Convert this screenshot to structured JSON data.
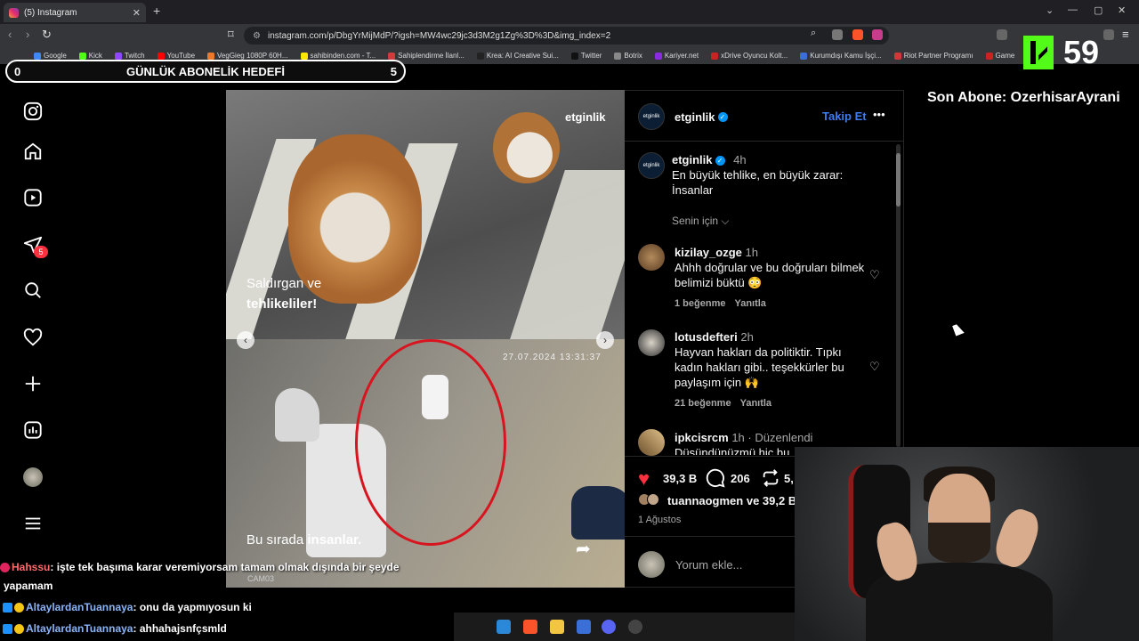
{
  "browser": {
    "tab_title": "(5) Instagram",
    "url": "instagram.com/p/DbgYrMijMdP/?igsh=MW4wc29jc3d3M2g1Zg%3D%3D&img_index=2",
    "bookmarks": [
      {
        "label": "Google",
        "color": "#4285f4"
      },
      {
        "label": "Kick",
        "color": "#53fc18"
      },
      {
        "label": "Twitch",
        "color": "#9146ff"
      },
      {
        "label": "YouTube",
        "color": "#ff0000"
      },
      {
        "label": "VegGieg 1080P 60H...",
        "color": "#e77a2e"
      },
      {
        "label": "sahibinden.com - T...",
        "color": "#ffe800"
      },
      {
        "label": "Sahiplendirme İlanl...",
        "color": "#d13b3b"
      },
      {
        "label": "Krea: AI Creative Sui...",
        "color": "#222222"
      },
      {
        "label": "Twitter",
        "color": "#111111"
      },
      {
        "label": "Botrix",
        "color": "#888888"
      },
      {
        "label": "Kariyer.net",
        "color": "#8a2be2"
      },
      {
        "label": "xDrive Oyuncu Kolt...",
        "color": "#cc2222"
      },
      {
        "label": "Kurumdışı Kamu İşçi...",
        "color": "#3a6fd8"
      },
      {
        "label": "Riot Partner Programı",
        "color": "#d13639"
      },
      {
        "label": "Game",
        "color": "#cc2222"
      }
    ]
  },
  "overlay": {
    "goal_start": "0",
    "goal_title": "GÜNLÜK ABONELİK HEDEFİ",
    "goal_end": "5",
    "viewers": "59",
    "last_sub": "Son Abone: OzerhisarAyrani"
  },
  "nav": {
    "notifications_badge": "5",
    "icons": [
      "instagram-icon",
      "home-icon",
      "reels-icon",
      "messages-icon",
      "search-icon",
      "heart-icon",
      "create-icon",
      "dashboard-icon",
      "profile-avatar",
      "menu-icon"
    ]
  },
  "post": {
    "watermark": "etginlik",
    "caption_top_1": "Saldırgan ve",
    "caption_top_2": "tehlikeliler!",
    "caption_bottom_1": "Bu sırada ",
    "caption_bottom_2": "insanlar.",
    "timestamp": "27.07.2024 13:31:37",
    "camera": "CAM03",
    "author": "etginlik",
    "avatar_text": "etginlik",
    "follow": "Takip Et",
    "more": "•••",
    "caption_user": "etginlik",
    "caption_time": "4h",
    "caption_text": "En büyük tehlike, en büyük zarar: İnsanlar",
    "for_you": "Senin için",
    "comments": [
      {
        "user": "kizilay_ozge",
        "time": "1h",
        "text": "Ahhh doğrular ve bu doğruları bilmek belimizi büktü 😳",
        "likes": "1 beğenme",
        "reply": "Yanıtla"
      },
      {
        "user": "lotusdefteri",
        "time": "2h",
        "text": "Hayvan hakları da politiktir. Tıpkı kadın hakları gibi.. teşekkürler bu paylaşım için 🙌",
        "likes": "21 beğenme",
        "reply": "Yanıtla"
      },
      {
        "user": "ipkcisrcm",
        "time": "1h",
        "edited": "Düzenlendi",
        "text": "Düşündünüzmü hiç bu..."
      }
    ],
    "like_count": "39,3 B",
    "comment_count": "206",
    "repost_count": "5,",
    "liked_by_user": "tuannaogmen",
    "liked_by_rest": " ve 39,2 B",
    "date": "1 Ağustos",
    "comment_placeholder": "Yorum ekle..."
  },
  "chat": [
    {
      "nick": "Hahssu",
      "text": ": işte tek başıma karar veremiyorsam tamam olmak dışında bir şeyde",
      "text2": "yapamam"
    },
    {
      "nick": "AltaylardanTuannaya",
      "text": ": onu da yapmıyosun ki"
    },
    {
      "nick": "AltaylardanTuannaya",
      "text": ": ahhahajsnfçsmld"
    }
  ]
}
